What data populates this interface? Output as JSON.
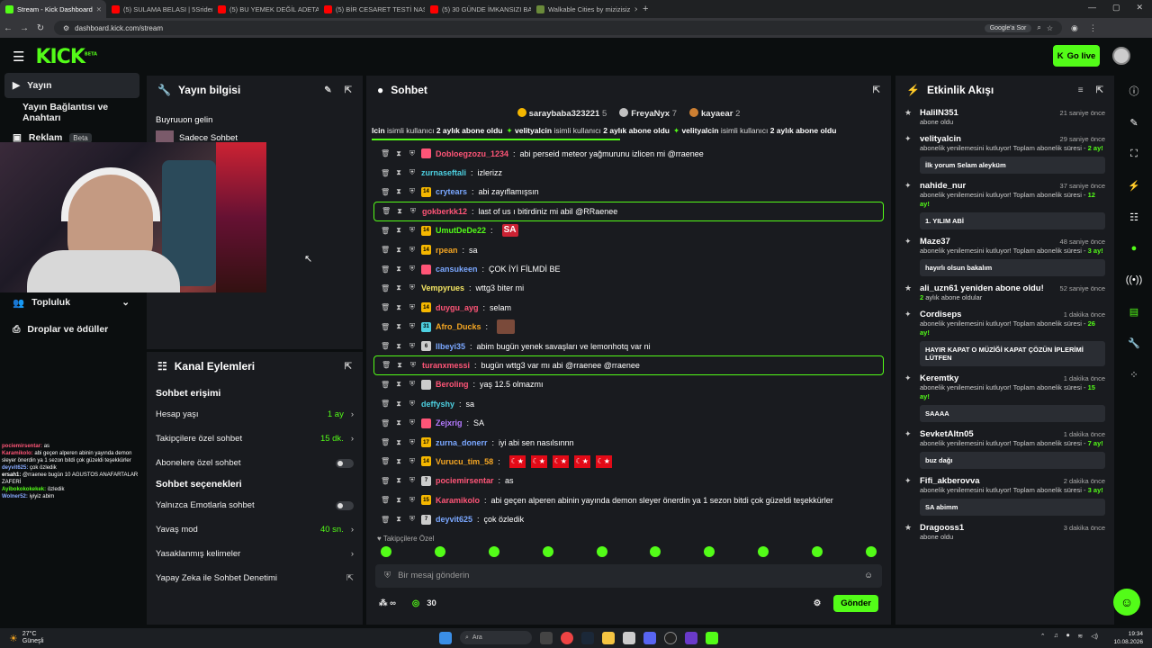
{
  "browser": {
    "tabs": [
      {
        "title": "Stream - Kick Dashboard",
        "color": "#53fc18",
        "active": true
      },
      {
        "title": "(5) SULAMA BELASI | 5Sriders |",
        "color": "#ff0000"
      },
      {
        "title": "(5) BU YEMEK DEĞİL ADETA ŞÖ",
        "color": "#ff0000"
      },
      {
        "title": "(5) BİR CESARET TESTİ NASIL FE",
        "color": "#ff0000"
      },
      {
        "title": "(5) 30 GÜNDE İMKANSIZI BAŞA",
        "color": "#ff0000"
      },
      {
        "title": "Walkable Cities by mizizisiz",
        "color": "#6a8a3a"
      }
    ],
    "url": "dashboard.kick.com/stream",
    "google_sor": "Google'a Sor"
  },
  "topnav": {
    "logo": "KICK",
    "logo_beta": "BETA",
    "go_live": "Go live"
  },
  "sidebar": {
    "items": [
      {
        "label": "Yayın",
        "icon": "video-icon",
        "active": true
      },
      {
        "label": "Yayın Bağlantısı ve Anahtarı",
        "icon": ""
      },
      {
        "label": "Reklam",
        "icon": "ad-icon",
        "badge": "Beta"
      },
      {
        "label": "Topluluk",
        "icon": "users-icon",
        "chevron": true
      },
      {
        "label": "Droplar ve ödüller",
        "icon": "gift-icon"
      }
    ]
  },
  "overlay_chat": [
    {
      "user": "pociemirsentar:",
      "text": "as",
      "color": "#ff5577"
    },
    {
      "user": "Karamikolo:",
      "text": "abi geçen alperen abinin yayında demon sleyer önerdin ya 1 sezon bitdi çok güzeldi teşekkürler",
      "color": "#ff5577"
    },
    {
      "user": "deyvit625:",
      "text": "çok özledik",
      "color": "#88aaff"
    },
    {
      "user": "ersah1:",
      "text": "@rraenee bugün 10 AGUSTOS ANAFARTALAR ZAFERİ",
      "color": "#ffffff"
    },
    {
      "user": "Ayibokokokekek:",
      "text": "özledik",
      "color": "#53fc18"
    },
    {
      "user": "Wolner52:",
      "text": "iyiyiz abim",
      "color": "#88aaff"
    }
  ],
  "yayin_bilgisi": {
    "title": "Yayın bilgisi",
    "welcome": "Buyruuon gelin",
    "mode": "Sadece Sohbet"
  },
  "kanal": {
    "title": "Kanal Eylemleri",
    "sohbet_erisimi": "Sohbet erişimi",
    "rows1": [
      {
        "label": "Hesap yaşı",
        "value": "1 ay",
        "type": "arrow"
      },
      {
        "label": "Takipçilere özel sohbet",
        "value": "15 dk.",
        "type": "arrow"
      },
      {
        "label": "Abonelere özel sohbet",
        "value": "",
        "type": "toggle"
      }
    ],
    "sohbet_secenekleri": "Sohbet seçenekleri",
    "rows2": [
      {
        "label": "Yalnızca Emotlarla sohbet",
        "value": "",
        "type": "toggle"
      },
      {
        "label": "Yavaş mod",
        "value": "40 sn.",
        "type": "arrow"
      },
      {
        "label": "Yasaklanmış kelimeler",
        "value": "",
        "type": "arrow"
      },
      {
        "label": "Yapay Zeka ile Sohbet Denetimi",
        "value": "",
        "type": "ext"
      }
    ]
  },
  "chat": {
    "title": "Sohbet",
    "top_gifters": [
      {
        "name": "saraybaba323221",
        "count": "5",
        "color": "#f5b700"
      },
      {
        "name": "FreyaNyx",
        "count": "7",
        "color": "#c0c0c0"
      },
      {
        "name": "kayaear",
        "count": "2",
        "color": "#cd7f32"
      }
    ],
    "ticker": [
      {
        "pre": "lcin",
        "mid": " isimli kullanıcı ",
        "bold": "2 aylık abone oldu"
      },
      {
        "pre": "velityalcin",
        "mid": " isimli kullanıcı ",
        "bold": "2 aylık abone oldu"
      },
      {
        "pre": "velityalcin",
        "mid": " isimli kullanıcı ",
        "bold": "2 aylık abone oldu"
      }
    ],
    "messages": [
      {
        "user": "Dobloegzozu_1234",
        "color": "#ff5577",
        "text": "abi perseid meteor yağmurunu izlicen mi @rraenee",
        "badge": "",
        "bcol": "#ff5577"
      },
      {
        "user": "zurnaseftali",
        "color": "#4dd0e1",
        "text": "izlerizz",
        "badge": "",
        "bcol": ""
      },
      {
        "user": "crytears",
        "color": "#7aa7ff",
        "text": "abi zayıflamışsın",
        "badge": "14",
        "bcol": "#f5b700"
      },
      {
        "user": "gokberkk12",
        "color": "#ff5577",
        "text": "last of us ı bitirdiniz mi abil @RRaenee",
        "badge": "",
        "bcol": "",
        "hl": true
      },
      {
        "user": "UmutDeDe22",
        "color": "#53fc18",
        "text": "",
        "badge": "14",
        "bcol": "#f5b700",
        "emote": "SA"
      },
      {
        "user": "rpean",
        "color": "#f5a623",
        "text": "sa",
        "badge": "14",
        "bcol": "#f5b700"
      },
      {
        "user": "cansukeen",
        "color": "#7aa7ff",
        "text": "ÇOK İYİ FİLMDİ BE",
        "badge": "",
        "bcol": "#ff5577"
      },
      {
        "user": "Vempyrues",
        "color": "#f5e663",
        "text": "wttg3 biter mi",
        "badge": "",
        "bcol": ""
      },
      {
        "user": "duygu_ayg",
        "color": "#ff5577",
        "text": "selam",
        "badge": "14",
        "bcol": "#f5b700"
      },
      {
        "user": "Afro_Ducks",
        "color": "#f5a623",
        "text": "",
        "badge": "31",
        "bcol": "#4dd0e1",
        "img": true
      },
      {
        "user": "llbeyi35",
        "color": "#7aa7ff",
        "text": "abim bugün yenek savaşları ve lemonhotq var ni",
        "badge": "6",
        "bcol": "#ccc"
      },
      {
        "user": "turanxmessi",
        "color": "#ff5577",
        "text": "bugün wttg3 var mı abi @rraenee @rraenee",
        "badge": "",
        "bcol": "",
        "hl": true
      },
      {
        "user": "Beroling",
        "color": "#ff5577",
        "text": "yaş 12.5 olmazmı",
        "badge": "",
        "bcol": "#ccc"
      },
      {
        "user": "deffyshy",
        "color": "#4dd0e1",
        "text": "sa",
        "badge": "",
        "bcol": ""
      },
      {
        "user": "Zejxrig",
        "color": "#b57aff",
        "text": "SA",
        "badge": "",
        "bcol": "#ff5577"
      },
      {
        "user": "zurna_donerr",
        "color": "#7aa7ff",
        "text": "iyi abi sen nasılsınnn",
        "badge": "17",
        "bcol": "#f5b700"
      },
      {
        "user": "Vurucu_tim_58",
        "color": "#f5a623",
        "text": "",
        "badge": "14",
        "bcol": "#f5b700",
        "flags": 5
      },
      {
        "user": "pociemirsentar",
        "color": "#ff5577",
        "text": "as",
        "badge": "7",
        "bcol": "#ccc"
      },
      {
        "user": "Karamikolo",
        "color": "#ff5577",
        "text": "abi geçen alperen abinin yayında demon sleyer önerdin ya 1 sezon bitdi çok güzeldi teşekkürler",
        "badge": "15",
        "bcol": "#f5b700"
      },
      {
        "user": "deyvit625",
        "color": "#7aa7ff",
        "text": "çok özledik",
        "badge": "7",
        "bcol": "#ccc"
      }
    ],
    "followers_only": "Takipçilere Özel",
    "placeholder": "Bir mesaj gönderin",
    "points": "30",
    "send": "Gönder"
  },
  "activity": {
    "title": "Etkinlik Akışı",
    "events": [
      {
        "name": "HalilN351",
        "time": "21 saniye önce",
        "desc": "abone oldu",
        "months": "",
        "msg": "",
        "sym": "★"
      },
      {
        "name": "velityalcin",
        "time": "29 saniye önce",
        "desc": "abonelik yenilemesini kutluyor! Toplam abonelik süresi -",
        "months": "2",
        "msg": "İlk yorum Selam aleyküm",
        "sym": "✦"
      },
      {
        "name": "nahide_nur",
        "time": "37 saniye önce",
        "desc": "abonelik yenilemesini kutluyor! Toplam abonelik süresi -",
        "months": "12",
        "msg": "1. YILIM ABİ",
        "sym": "✦"
      },
      {
        "name": "Maze37",
        "time": "48 saniye önce",
        "desc": "abonelik yenilemesini kutluyor! Toplam abonelik süresi -",
        "months": "3",
        "msg": "hayırlı olsun bakalım",
        "sym": "✦"
      },
      {
        "name": "ali_uzn61 yeniden abone oldu!",
        "time": "52 saniye önce",
        "desc": "aylık abone oldular",
        "months": "2",
        "msg": "",
        "sym": "★",
        "prefix": true
      },
      {
        "name": "Cordiseps",
        "time": "1 dakika önce",
        "desc": "abonelik yenilemesini kutluyor! Toplam abonelik süresi -",
        "months": "26",
        "msg": "HAYIR KAPAT O MÜZİĞİ KAPAT ÇÖZÜN İPLERİMİ LÜTFEN",
        "sym": "✦"
      },
      {
        "name": "Keremtky",
        "time": "1 dakika önce",
        "desc": "abonelik yenilemesini kutluyor! Toplam abonelik süresi -",
        "months": "15",
        "msg": "SAAAA",
        "sym": "✦"
      },
      {
        "name": "SevketAltn05",
        "time": "1 dakika önce",
        "desc": "abonelik yenilemesini kutluyor! Toplam abonelik süresi -",
        "months": "7",
        "msg": "buz dağı",
        "sym": "✦"
      },
      {
        "name": "Fifi_akberovva",
        "time": "2 dakika önce",
        "desc": "abonelik yenilemesini kutluyor! Toplam abonelik süresi -",
        "months": "3",
        "msg": "SA abimm",
        "sym": "✦"
      },
      {
        "name": "Dragooss1",
        "time": "3 dakika önce",
        "desc": "abone oldu",
        "months": "",
        "msg": "",
        "sym": "★"
      }
    ]
  },
  "taskbar": {
    "weather_temp": "27°C",
    "weather_desc": "Güneşli",
    "search": "Ara",
    "time": "19:34",
    "date": "10.08.2026"
  },
  "months_suffix": "ay!"
}
